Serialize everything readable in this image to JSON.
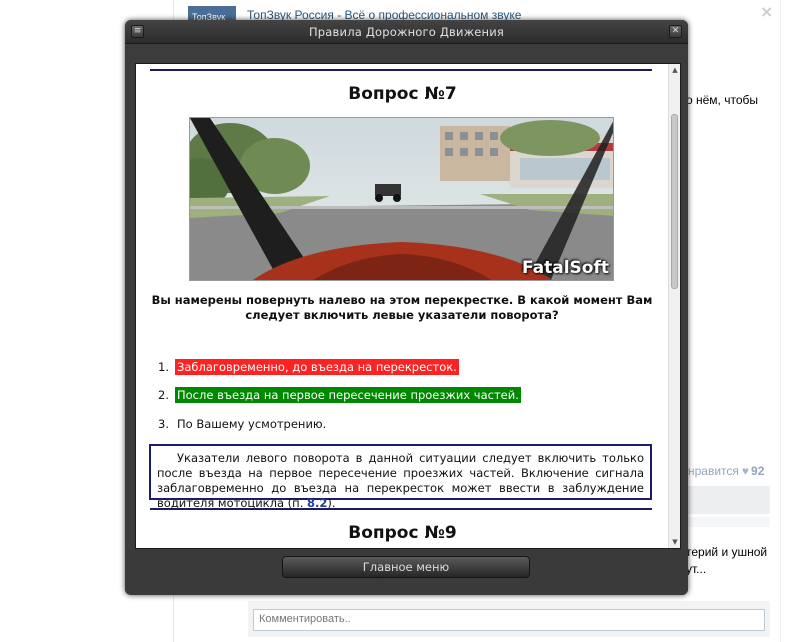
{
  "background": {
    "group_logo_text": "ТопЗвук",
    "group_title": "ТопЗвук Россия - Всё о профессиональном звуке",
    "close_glyph": "×",
    "post_fragment_1": "о нём, чтобы",
    "likes": {
      "label": "нравится",
      "count": "92",
      "heart": "♥"
    },
    "post_fragment_2_line1": "терий и ушной",
    "post_fragment_2_line2": "ут...",
    "comment_placeholder": "Комментировать.."
  },
  "modal": {
    "title": "Правила Дорожного Движения",
    "menu_glyph": "≡",
    "close_glyph": "✕",
    "footer_button": "Главное меню"
  },
  "question": {
    "title": "Вопрос №7",
    "image_watermark": "FatalSoft",
    "text": "Вы намерены повернуть налево на этом перекрестке. В какой момент Вам следует включить левые указатели поворота?",
    "answers": [
      {
        "number": "1.",
        "text": "Заблаговременно, до въезда на перекресток.",
        "status": "wrong",
        "color": "#ff2222"
      },
      {
        "number": "2.",
        "text": "После въезда на первое пересечение проезжих частей.",
        "status": "correct",
        "color": "#008800"
      },
      {
        "number": "3.",
        "text": "По Вашему усмотрению.",
        "status": "neutral"
      }
    ],
    "explanation_text": "Указатели левого поворота в данной ситуации следует включить только после въезда на первое пересечение проезжих частей. Включение сигнала заблаговременно до въезда на перекресток может ввести в заблуждение водителя мотоцикла (п. ",
    "explanation_ref": "8.2",
    "explanation_end": ")."
  },
  "next_question": {
    "title": "Вопрос №9"
  },
  "colors": {
    "accent_rule": "#1c1c5a",
    "link": "#2b587a"
  }
}
